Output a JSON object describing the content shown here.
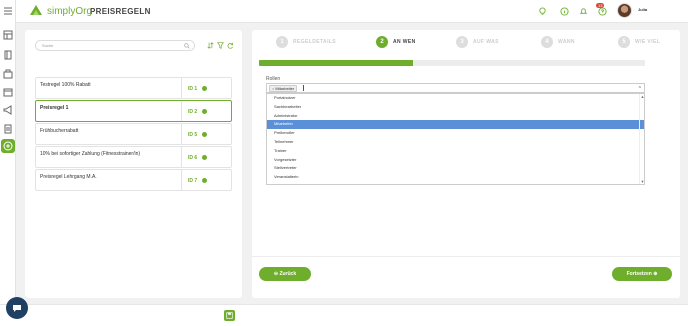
{
  "app": {
    "brand": "simplyOrg",
    "page_title": "PREISREGELN",
    "user_name": "Julia",
    "notification_count": "13"
  },
  "colors": {
    "accent": "#6fae2d",
    "highlight": "#5b8fd8",
    "badge": "#d9473c"
  },
  "search": {
    "placeholder": "Suche"
  },
  "rules": [
    {
      "name": "Testregel 100% Rabatt",
      "id": "ID 1",
      "selected": false
    },
    {
      "name": "Preisregel 1",
      "id": "ID 2",
      "selected": true
    },
    {
      "name": "Frühbucherrabatt",
      "id": "ID 5",
      "selected": false
    },
    {
      "name": "10% bei sofortiger Zahlung (Fitnesstrainer/in)",
      "id": "ID 6",
      "selected": false
    },
    {
      "name": "Preisregel Lehrgang M.A.",
      "id": "ID 7",
      "selected": false
    }
  ],
  "wizard": {
    "steps": [
      {
        "num": "1",
        "label": "REGELDETAILS",
        "active": false
      },
      {
        "num": "2",
        "label": "AN WEN",
        "active": true
      },
      {
        "num": "3",
        "label": "AUF WAS",
        "active": false
      },
      {
        "num": "4",
        "label": "WANN",
        "active": false
      },
      {
        "num": "5",
        "label": "WIE VIEL",
        "active": false
      }
    ],
    "progress_fraction": 0.4,
    "roles_label": "Rollen",
    "selected_tag": "Mitarbeiter",
    "options": [
      "Portalnutzer",
      "Sachbearbeiter",
      "Administrator",
      "Mitarbeiter",
      "Preiberufler",
      "Teilnehmer",
      "Trainer",
      "Vorgesetzter",
      "Stellvertreter",
      "Veranstalterin"
    ],
    "highlighted_option": "Mitarbeiter",
    "back_label": "Zurück",
    "next_label": "Fortsetzen"
  }
}
